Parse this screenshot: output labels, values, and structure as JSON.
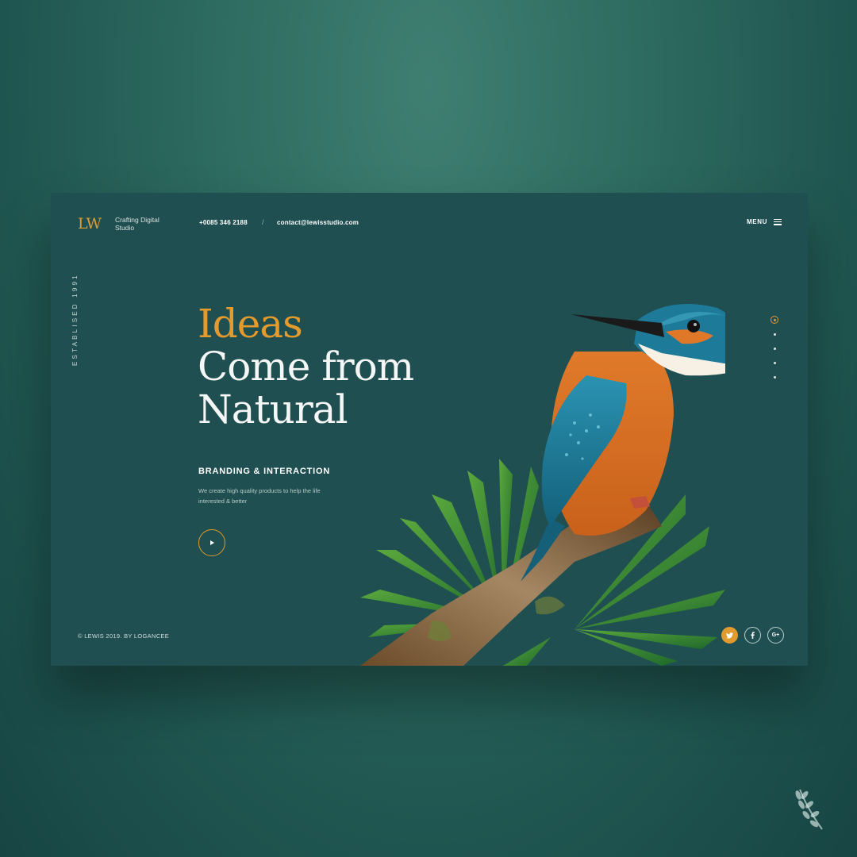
{
  "header": {
    "logo": "LW",
    "tagline": "Crafting Digital Studio",
    "phone": "+0085 346 2188",
    "separator": "/",
    "email": "contact@lewisstudio.com",
    "menu_label": "MENU"
  },
  "side": {
    "established": "ESTABLISED 1991"
  },
  "hero": {
    "headline_accent": "Ideas",
    "headline_line2": "Come from",
    "headline_line3": "Natural",
    "subheading": "BRANDING & INTERACTION",
    "description": "We create high quality products to help the life interested & better"
  },
  "footer": {
    "copyright": "© LEWIS 2019.  BY LOGANCEE"
  },
  "slider": {
    "total_slides": 5,
    "active_slide": 1
  },
  "socials": [
    {
      "name": "twitter",
      "glyph": "t",
      "active": true
    },
    {
      "name": "facebook",
      "glyph": "f",
      "active": false
    },
    {
      "name": "google-plus",
      "glyph": "G+",
      "active": false
    }
  ],
  "colors": {
    "background": "#2e6b60",
    "card": "#1f4f51",
    "accent": "#e39a2c",
    "text": "#f4f7f5"
  },
  "icons": [
    "hamburger-icon",
    "play-icon",
    "twitter-icon",
    "facebook-icon",
    "google-plus-icon",
    "laurel-icon"
  ]
}
